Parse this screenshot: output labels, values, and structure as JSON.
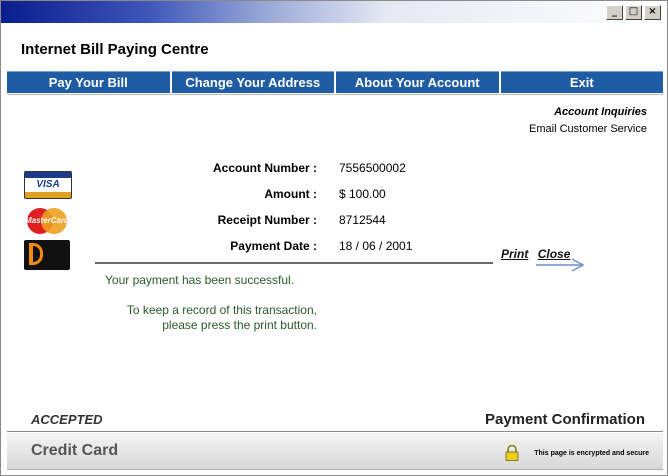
{
  "window": {
    "controls": [
      "_",
      "□",
      "×"
    ]
  },
  "app": {
    "title": "Internet Bill Paying Centre"
  },
  "nav": {
    "items": [
      {
        "label": "Pay Your Bill"
      },
      {
        "label": "Change Your Address"
      },
      {
        "label": "About Your Account"
      },
      {
        "label": "Exit"
      }
    ]
  },
  "inquiries": {
    "heading": "Account Inquiries",
    "link": "Email Customer Service"
  },
  "cards": {
    "visa": "VISA",
    "mastercard": "MasterCard"
  },
  "details": {
    "account_number_label": "Account Number :",
    "account_number": "7556500002",
    "amount_label": "Amount :",
    "amount": "$ 100.00",
    "receipt_label": "Receipt Number :",
    "receipt": "8712544",
    "date_label": "Payment Date :",
    "date": "18 / 06 / 2001"
  },
  "actions": {
    "print": "Print",
    "close": "Close"
  },
  "messages": {
    "success": "Your payment has been successful.",
    "record_line1": "To keep a record of this transaction,",
    "record_line2": "please press the print button."
  },
  "status": {
    "accepted": "ACCEPTED",
    "confirmation": "Payment Confirmation"
  },
  "footer": {
    "method": "Credit Card",
    "security": "This page is encrypted and secure"
  },
  "colors": {
    "nav_bg": "#1f5ca3",
    "message_text": "#2a5a2a"
  }
}
